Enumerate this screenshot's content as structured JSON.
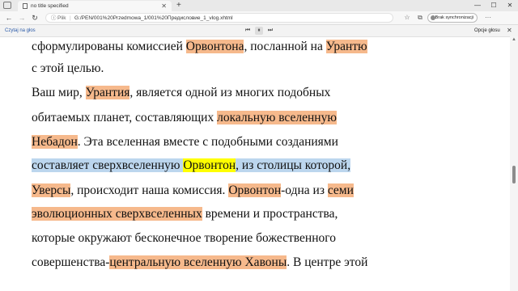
{
  "tab": {
    "title": "no title specified",
    "close": "✕",
    "new_tab": "+"
  },
  "window": {
    "minimize": "—",
    "maximize": "☐",
    "close": "✕"
  },
  "nav": {
    "back": "←",
    "forward": "→",
    "reload": "↻",
    "info": "ⓘ",
    "scheme_label": "Plik",
    "separator": "|",
    "url": "G:/PEN/001%20Przedmowa_1/001%20Предисловие_1_vlog.xhtml",
    "sync_label": "Brak synchronizacji",
    "more": "···"
  },
  "read_aloud": {
    "label": "Czytaj na głos",
    "prev": "⏮",
    "pause": "⏸",
    "next": "⏭",
    "voice_options": "Opcje głosu",
    "close": "✕"
  },
  "content": {
    "lines": [
      [
        {
          "t": "сформулированы комиссией "
        },
        {
          "t": "Орвонтона",
          "h": "o"
        },
        {
          "t": ", посланной на "
        },
        {
          "t": "Урантю",
          "h": "o"
        }
      ],
      [
        {
          "t": "с этой целью."
        }
      ],
      [
        {
          "t": "Ваш мир, "
        },
        {
          "t": "Урантия",
          "h": "o"
        },
        {
          "t": ", является одной из многих подобных"
        }
      ],
      [
        {
          "t": "обитаемых планет, составляющих "
        },
        {
          "t": "локальную вселенную",
          "h": "o"
        }
      ],
      [
        {
          "t": "Небадон",
          "h": "o"
        },
        {
          "t": ". Эта вселенная вместе с подобными созданиями"
        }
      ],
      [
        {
          "t": "составляет",
          "h": "b"
        },
        {
          "t": " ",
          "h": "b"
        },
        {
          "t": "сверхвселенную",
          "h": "b"
        },
        {
          "t": " ",
          "h": "b"
        },
        {
          "t": "Орвонтон",
          "h": "y"
        },
        {
          "t": ", из столицы которой,",
          "h": "b"
        }
      ],
      [
        {
          "t": "Уверсы",
          "h": "o"
        },
        {
          "t": ", происходит наша комиссия. "
        },
        {
          "t": "Орвонтон",
          "h": "o"
        },
        {
          "t": "-одна из "
        },
        {
          "t": "семи",
          "h": "o"
        }
      ],
      [
        {
          "t": "эволюционных сверхвселенных",
          "h": "o"
        },
        {
          "t": " времени и пространства,"
        }
      ],
      [
        {
          "t": "которые окружают бесконечное творение божественного"
        }
      ],
      [
        {
          "t": "совершенства-"
        },
        {
          "t": "центральную вселенную Хавоны",
          "h": "o"
        },
        {
          "t": ". В центре этой"
        }
      ]
    ]
  }
}
